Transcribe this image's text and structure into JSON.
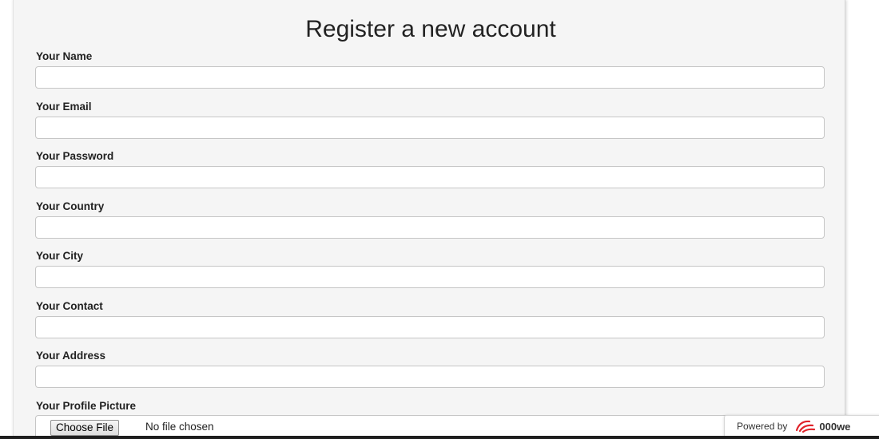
{
  "form": {
    "title": "Register a new account",
    "fields": [
      {
        "label": "Your Name",
        "value": "",
        "placeholder": ""
      },
      {
        "label": "Your Email",
        "value": "",
        "placeholder": ""
      },
      {
        "label": "Your Password",
        "value": "",
        "placeholder": ""
      },
      {
        "label": "Your Country",
        "value": "",
        "placeholder": ""
      },
      {
        "label": "Your City",
        "value": "",
        "placeholder": ""
      },
      {
        "label": "Your Contact",
        "value": "",
        "placeholder": ""
      },
      {
        "label": "Your Address",
        "value": "",
        "placeholder": ""
      }
    ],
    "profile_picture": {
      "label": "Your Profile Picture",
      "button_label": "Choose File",
      "status": "No file chosen"
    }
  },
  "badge": {
    "label": "Powered by",
    "brand": "000we",
    "logo_icon": "000webhost-swirl-icon",
    "logo_color": "#e0242b"
  },
  "colors": {
    "panel_background": "#f5f5f5",
    "input_border": "#c6c6c6"
  }
}
